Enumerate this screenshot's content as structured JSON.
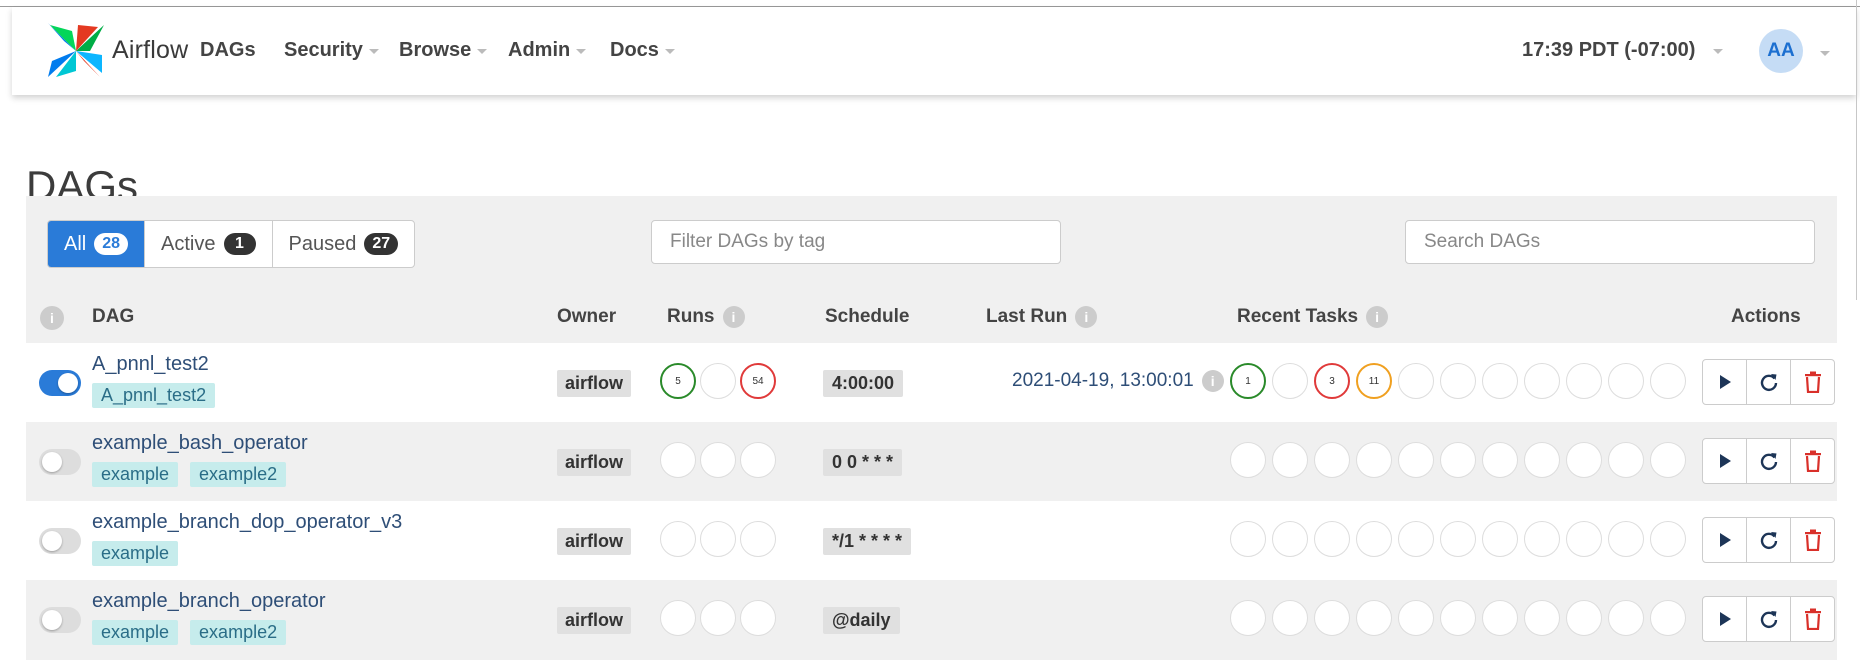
{
  "app": {
    "brand": "Airflow",
    "clock": "17:39 PDT (-07:00)",
    "user_initials": "AA"
  },
  "nav": [
    {
      "label": "DAGs",
      "has_caret": false
    },
    {
      "label": "Security",
      "has_caret": true
    },
    {
      "label": "Browse",
      "has_caret": true
    },
    {
      "label": "Admin",
      "has_caret": true
    },
    {
      "label": "Docs",
      "has_caret": true
    }
  ],
  "page": {
    "title": "DAGs"
  },
  "filters": {
    "all": {
      "label": "All",
      "count": "28"
    },
    "active": {
      "label": "Active",
      "count": "1"
    },
    "paused": {
      "label": "Paused",
      "count": "27"
    }
  },
  "tag_filter": {
    "placeholder": "Filter DAGs by tag"
  },
  "search": {
    "placeholder": "Search DAGs"
  },
  "table": {
    "headers": {
      "info": "i",
      "dag": "DAG",
      "owner": "Owner",
      "runs": "Runs",
      "schedule": "Schedule",
      "last_run": "Last Run",
      "recent_tasks": "Recent Tasks",
      "actions": "Actions"
    },
    "rows": [
      {
        "enabled": true,
        "dag": "A_pnnl_test2",
        "tags": [
          "A_pnnl_test2"
        ],
        "owner": "airflow",
        "runs": [
          {
            "count": "5",
            "state": "green"
          },
          {
            "count": "",
            "state": "empty"
          },
          {
            "count": "54",
            "state": "red"
          }
        ],
        "schedule": "4:00:00",
        "last_run": "2021-04-19, 13:00:01",
        "recent_tasks": [
          {
            "count": "1",
            "state": "green"
          },
          {
            "count": "",
            "state": "empty"
          },
          {
            "count": "3",
            "state": "red"
          },
          {
            "count": "11",
            "state": "orange"
          }
        ]
      },
      {
        "enabled": false,
        "dag": "example_bash_operator",
        "tags": [
          "example",
          "example2"
        ],
        "owner": "airflow",
        "runs": [],
        "schedule": "0 0 * * *",
        "last_run": "",
        "recent_tasks": []
      },
      {
        "enabled": false,
        "dag": "example_branch_dop_operator_v3",
        "tags": [
          "example"
        ],
        "owner": "airflow",
        "runs": [],
        "schedule": "*/1 * * * *",
        "last_run": "",
        "recent_tasks": []
      },
      {
        "enabled": false,
        "dag": "example_branch_operator",
        "tags": [
          "example",
          "example2"
        ],
        "owner": "airflow",
        "runs": [],
        "schedule": "@daily",
        "last_run": "",
        "recent_tasks": []
      }
    ]
  },
  "colors": {
    "primary": "#2a7bd8",
    "success": "#2a8a2a",
    "failed": "#e03a3a",
    "retry": "#f0a020",
    "tag_bg": "#c6ecec",
    "delete": "#d9302a"
  },
  "icons": {
    "trigger": "play-icon",
    "refresh": "refresh-icon",
    "delete": "trash-icon",
    "info": "info-icon"
  }
}
